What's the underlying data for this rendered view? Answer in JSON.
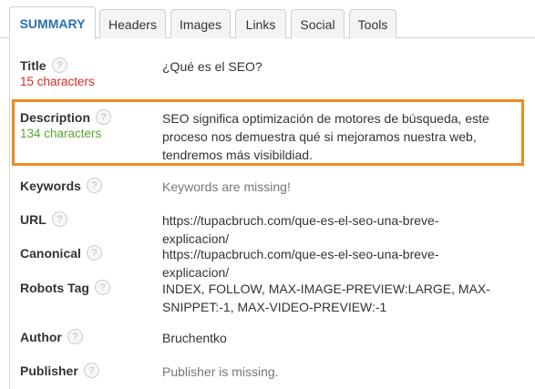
{
  "tabs": [
    "SUMMARY",
    "Headers",
    "Images",
    "Links",
    "Social",
    "Tools"
  ],
  "help_glyph": "?",
  "accent_colors": {
    "active_tab": "#2a6fad",
    "highlight": "#f08a22",
    "bad": "#d62a2a",
    "good": "#5aa82f"
  },
  "summary": {
    "title": {
      "label": "Title",
      "count": "15 characters",
      "value": "¿Qué es el SEO?"
    },
    "description": {
      "label": "Description",
      "count": "134 characters",
      "value": "SEO significa optimización de motores de búsqueda, este proceso nos demuestra qué si mejoramos nuestra web, tendremos más visibildiad."
    },
    "keywords": {
      "label": "Keywords",
      "value": "Keywords are missing!"
    },
    "url": {
      "label": "URL",
      "value": "https://tupacbruch.com/que-es-el-seo-una-breve-explicacion/"
    },
    "canonical": {
      "label": "Canonical",
      "value": "https://tupacbruch.com/que-es-el-seo-una-breve-explicacion/"
    },
    "robots": {
      "label": "Robots Tag",
      "value": "INDEX, FOLLOW, MAX-IMAGE-PREVIEW:LARGE, MAX-SNIPPET:-1, MAX-VIDEO-PREVIEW:-1"
    },
    "author": {
      "label": "Author",
      "value": "Bruchentko"
    },
    "publisher": {
      "label": "Publisher",
      "value": "Publisher is missing."
    }
  }
}
